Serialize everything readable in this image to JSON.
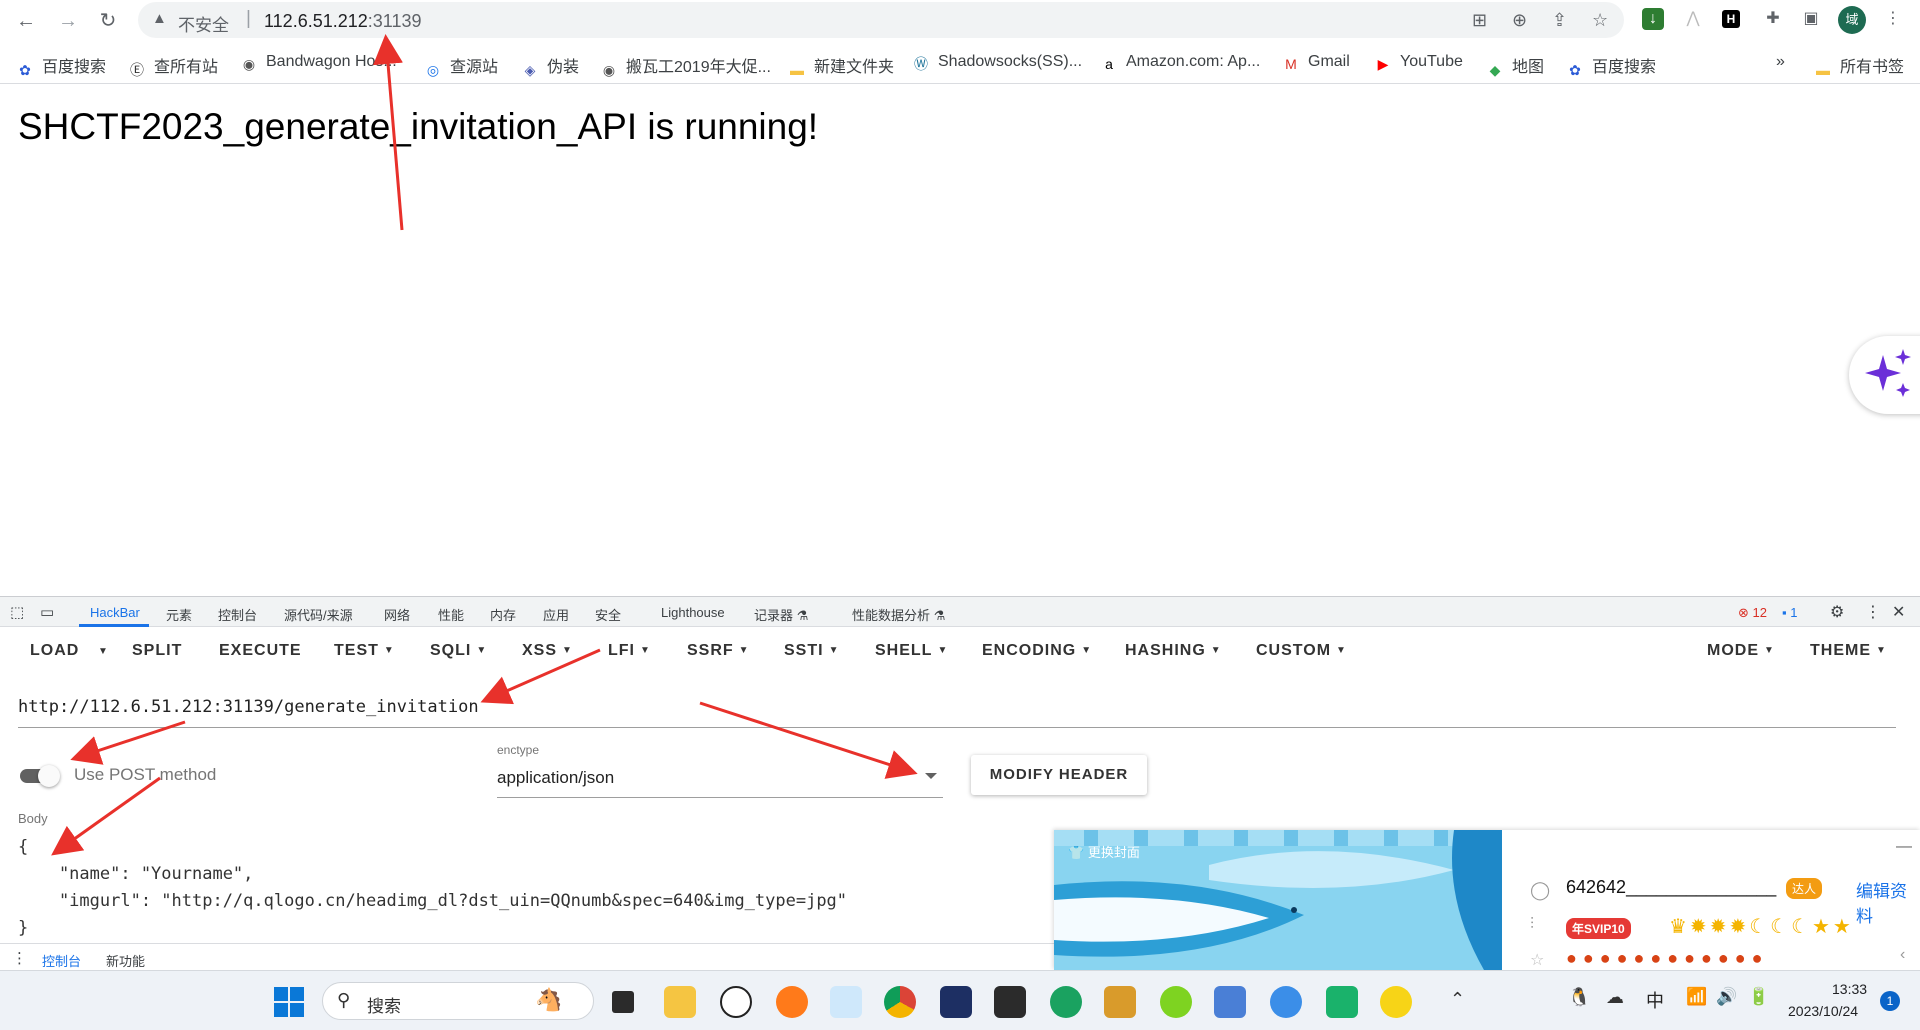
{
  "browser": {
    "insecure_label": "不安全",
    "url_host": "112.6.51.212",
    "url_port": ":31139"
  },
  "bookmarks": [
    {
      "label": "百度搜索",
      "icon": "baidu-icon"
    },
    {
      "label": "查所有站",
      "icon": "site-icon"
    },
    {
      "label": "Bandwagon Hos...",
      "icon": "globe-icon"
    },
    {
      "label": "查源站",
      "icon": "location-icon"
    },
    {
      "label": "伪装",
      "icon": "shield-icon"
    },
    {
      "label": "搬瓦工2019年大促...",
      "icon": "globe-icon"
    },
    {
      "label": "新建文件夹",
      "icon": "folder-icon"
    },
    {
      "label": "Shadowsocks(SS)...",
      "icon": "wordpress-icon"
    },
    {
      "label": "Amazon.com: Ap...",
      "icon": "amazon-icon"
    },
    {
      "label": "Gmail",
      "icon": "gmail-icon"
    },
    {
      "label": "YouTube",
      "icon": "youtube-icon"
    },
    {
      "label": "地图",
      "icon": "maps-icon"
    },
    {
      "label": "百度搜索",
      "icon": "baidu-icon"
    }
  ],
  "bookmarks_more": "»",
  "bookmarks_all": "所有书签",
  "page": {
    "heading": "SHCTF2023_generate_invitation_API is running!"
  },
  "devtools": {
    "tabs": [
      "HackBar",
      "元素",
      "控制台",
      "源代码/来源",
      "网络",
      "性能",
      "内存",
      "应用",
      "安全",
      "Lighthouse",
      "记录器 ⚗",
      "性能数据分析 ⚗"
    ],
    "errors": "12",
    "messages": "1",
    "drawer_tabs": [
      "控制台",
      "新功能"
    ]
  },
  "hackbar": {
    "toolbar": [
      "LOAD",
      "SPLIT",
      "EXECUTE",
      "TEST",
      "SQLI",
      "XSS",
      "LFI",
      "SSRF",
      "SSTI",
      "SHELL",
      "ENCODING",
      "HASHING",
      "CUSTOM"
    ],
    "mode": "MODE",
    "theme": "THEME",
    "url": "http://112.6.51.212:31139/generate_invitation",
    "post_toggle_label": "Use POST method",
    "post_enabled": true,
    "enctype_label": "enctype",
    "enctype_value": "application/json",
    "modify_header": "MODIFY HEADER",
    "body_label": "Body",
    "body_lines": [
      "{",
      "    \"name\": \"Yourname\",",
      "    \"imgurl\": \"http://q.qlogo.cn/headimg_dl?dst_uin=QQnumb&spec=640&img_type=jpg\"",
      "}"
    ]
  },
  "qq_popup": {
    "banner_label": "更换封面",
    "qq_number": "642642_______________",
    "badge": "达人",
    "edit_label": "编辑资料",
    "vip": "年SVIP10"
  },
  "taskbar": {
    "search_placeholder": "搜索",
    "ime": "中",
    "time": "13:33",
    "date": "2023/10/24",
    "notification_count": "1"
  }
}
